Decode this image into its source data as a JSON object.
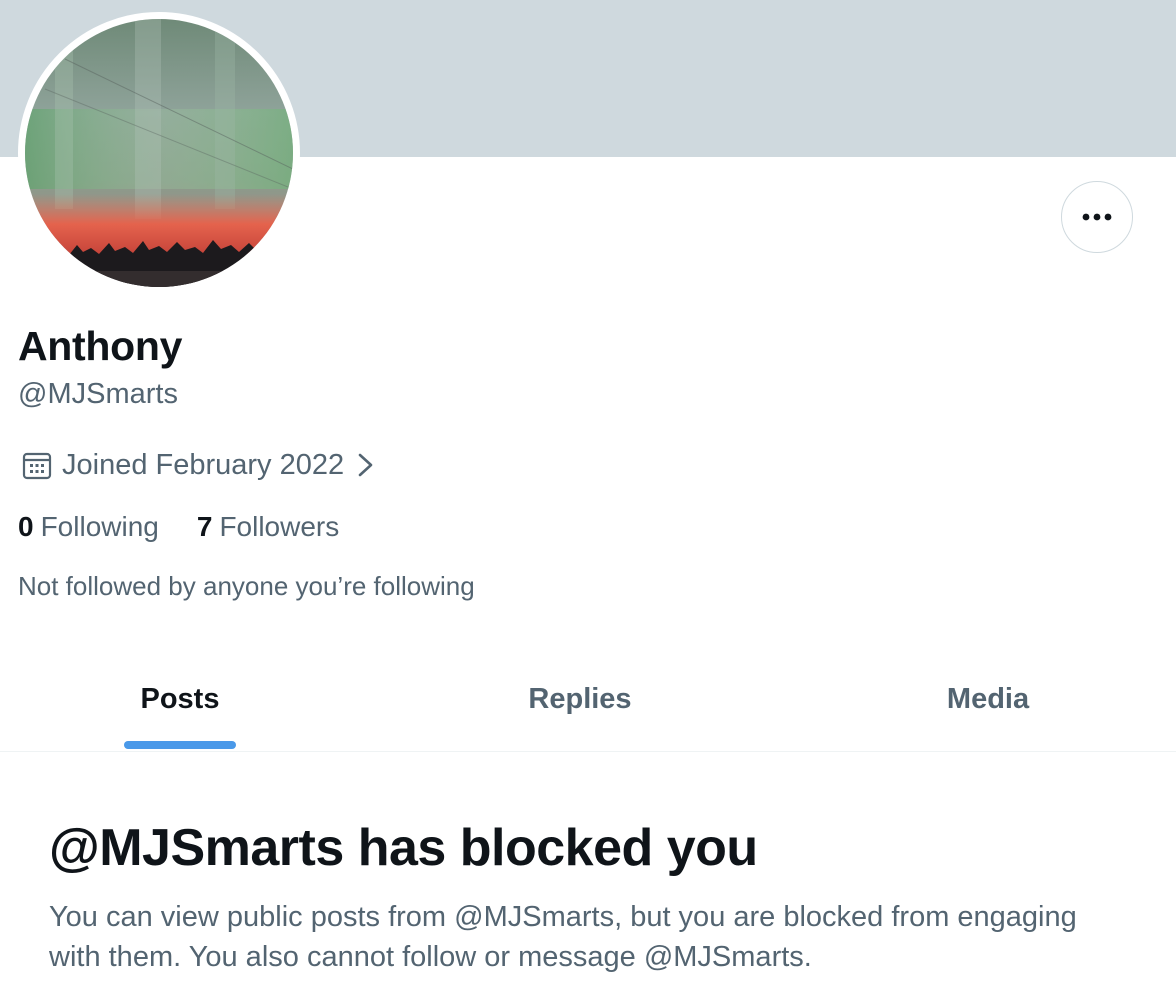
{
  "profile": {
    "display_name": "Anthony",
    "handle": "@MJSmarts",
    "joined": "Joined February 2022",
    "following_count": "0",
    "following_label": "Following",
    "followers_count": "7",
    "followers_label": "Followers",
    "not_followed_text": "Not followed by anyone you’re following"
  },
  "icons": {
    "more": "more-horizontal-icon",
    "calendar": "calendar-icon",
    "chevron": "chevron-right-icon"
  },
  "tabs": [
    {
      "label": "Posts",
      "active": true
    },
    {
      "label": "Replies",
      "active": false
    },
    {
      "label": "Media",
      "active": false
    }
  ],
  "blocked": {
    "title": "@MJSmarts has blocked you",
    "message": "You can view public posts from @MJSmarts, but you are blocked from engaging with them. You also cannot follow or message @MJSmarts."
  },
  "colors": {
    "banner": "#cfd9de",
    "secondary_text": "#536471",
    "primary_text": "#0f1419",
    "tab_indicator": "#4a99e9"
  }
}
